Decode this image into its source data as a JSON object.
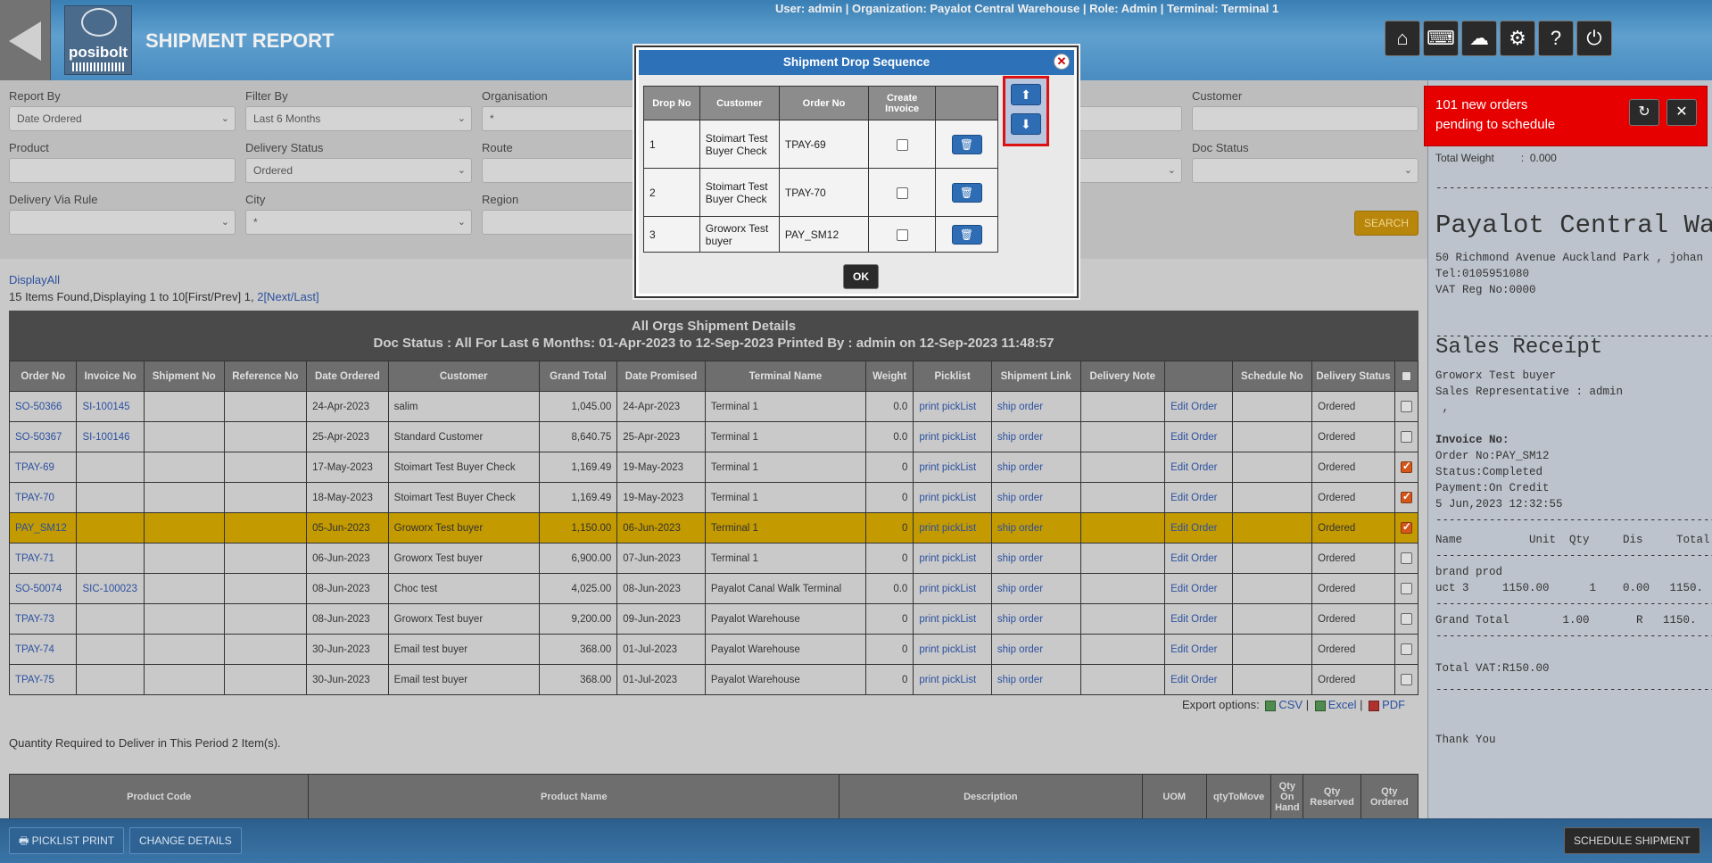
{
  "header": {
    "title": "SHIPMENT REPORT",
    "logo_text": "posibolt",
    "user_info": "User: admin | Organization: Payalot Central Warehouse | Role: Admin | Terminal: Terminal 1",
    "icons": [
      "home-icon",
      "keyboard-icon",
      "cloud-icon",
      "settings-icon",
      "help-icon",
      "power-icon"
    ]
  },
  "filters": {
    "report_by_label": "Report By",
    "report_by_value": "Date Ordered",
    "filter_by_label": "Filter By",
    "filter_by_value": "Last 6 Months",
    "organisation_label": "Organisation",
    "organisation_value": "*",
    "customer_label": "Customer",
    "customer_value": "",
    "product_label": "Product",
    "product_value": "",
    "delivery_status_label": "Delivery Status",
    "delivery_status_value": "Ordered",
    "route_label": "Route",
    "route_value": "",
    "doc_status_label": "Doc Status",
    "doc_status_value": "",
    "delivery_via_rule_label": "Delivery Via Rule",
    "delivery_via_rule_value": "",
    "city_label": "City",
    "city_value": "*",
    "region_label": "Region",
    "region_value": "",
    "search_label": "SEARCH"
  },
  "paging": {
    "display_all": "DisplayAll",
    "summary": "15 Items Found,Displaying 1 to 10[First/Prev] ",
    "page1": "1",
    "sep": ", ",
    "page2": "2",
    "next_last": "[Next/Last]"
  },
  "report": {
    "title": "All Orgs Shipment Details",
    "subtitle": "Doc Status : All For Last 6 Months: 01-Apr-2023 to 12-Sep-2023 Printed By : admin on 12-Sep-2023 11:48:57",
    "columns": [
      "Order No",
      "Invoice No",
      "Shipment No",
      "Reference No",
      "Date Ordered",
      "Customer",
      "Grand Total",
      "Date Promised",
      "Terminal Name",
      "Weight",
      "Picklist",
      "Shipment Link",
      "Delivery Note",
      "",
      "Schedule No",
      "Delivery Status"
    ],
    "picklist_text": "print pickList",
    "ship_text": "ship order",
    "edit_text": "Edit Order",
    "rows": [
      {
        "order": "SO-50366",
        "invoice": "SI-100145",
        "date": "24-Apr-2023",
        "customer": "salim",
        "total": "1,045.00",
        "promised": "24-Apr-2023",
        "terminal": "Terminal 1",
        "weight": "0.0",
        "status": "Ordered",
        "checked": false,
        "hl": false
      },
      {
        "order": "SO-50367",
        "invoice": "SI-100146",
        "date": "25-Apr-2023",
        "customer": "Standard Customer",
        "total": "8,640.75",
        "promised": "25-Apr-2023",
        "terminal": "Terminal 1",
        "weight": "0.0",
        "status": "Ordered",
        "checked": false,
        "hl": false
      },
      {
        "order": "TPAY-69",
        "invoice": "",
        "date": "17-May-2023",
        "customer": "Stoimart Test Buyer Check",
        "total": "1,169.49",
        "promised": "19-May-2023",
        "terminal": "Terminal 1",
        "weight": "0",
        "status": "Ordered",
        "checked": true,
        "hl": false
      },
      {
        "order": "TPAY-70",
        "invoice": "",
        "date": "18-May-2023",
        "customer": "Stoimart Test Buyer Check",
        "total": "1,169.49",
        "promised": "19-May-2023",
        "terminal": "Terminal 1",
        "weight": "0",
        "status": "Ordered",
        "checked": true,
        "hl": false
      },
      {
        "order": "PAY_SM12",
        "invoice": "",
        "date": "05-Jun-2023",
        "customer": "Groworx Test buyer",
        "total": "1,150.00",
        "promised": "06-Jun-2023",
        "terminal": "Terminal 1",
        "weight": "0",
        "status": "Ordered",
        "checked": true,
        "hl": true
      },
      {
        "order": "TPAY-71",
        "invoice": "",
        "date": "06-Jun-2023",
        "customer": "Groworx Test buyer",
        "total": "6,900.00",
        "promised": "07-Jun-2023",
        "terminal": "Terminal 1",
        "weight": "0",
        "status": "Ordered",
        "checked": false,
        "hl": false
      },
      {
        "order": "SO-50074",
        "invoice": "SIC-100023",
        "date": "08-Jun-2023",
        "customer": "Choc test",
        "total": "4,025.00",
        "promised": "08-Jun-2023",
        "terminal": "Payalot Canal Walk Terminal",
        "weight": "0.0",
        "status": "Ordered",
        "checked": false,
        "hl": false
      },
      {
        "order": "TPAY-73",
        "invoice": "",
        "date": "08-Jun-2023",
        "customer": "Groworx Test buyer",
        "total": "9,200.00",
        "promised": "09-Jun-2023",
        "terminal": "Payalot Warehouse",
        "weight": "0",
        "status": "Ordered",
        "checked": false,
        "hl": false
      },
      {
        "order": "TPAY-74",
        "invoice": "",
        "date": "30-Jun-2023",
        "customer": "Email test buyer",
        "total": "368.00",
        "promised": "01-Jul-2023",
        "terminal": "Payalot Warehouse",
        "weight": "0",
        "status": "Ordered",
        "checked": false,
        "hl": false
      },
      {
        "order": "TPAY-75",
        "invoice": "",
        "date": "30-Jun-2023",
        "customer": "Email test buyer",
        "total": "368.00",
        "promised": "01-Jul-2023",
        "terminal": "Payalot Warehouse",
        "weight": "0",
        "status": "Ordered",
        "checked": false,
        "hl": false
      }
    ]
  },
  "export": {
    "label": "Export options:",
    "csv": "CSV",
    "excel": "Excel",
    "pdf": "PDF",
    "sep": " | "
  },
  "qty_text": "Quantity Required to Deliver in This Period 2 Item(s).",
  "product_table": {
    "columns": [
      "Product Code",
      "Product Name",
      "Description",
      "UOM",
      "qtyToMove",
      "Qty On Hand",
      "Qty Reserved",
      "Qty Ordered"
    ]
  },
  "bottom": {
    "picklist_print": "PICKLIST PRINT",
    "change_details": "CHANGE DETAILS",
    "schedule_shipment": "SCHEDULE SHIPMENT"
  },
  "toast": {
    "line1": "101 new orders",
    "line2": "pending to schedule"
  },
  "receipt": {
    "total_weight": "Total Weight         :  0.000",
    "dashes": "--------------------------------------------",
    "store": "Payalot Central Wa",
    "address": "50 Richmond Avenue Auckland Park , johan",
    "tel": "Tel:0105951080",
    "vat": "VAT Reg No:0000",
    "heading": "Sales Receipt",
    "customer": "Groworx Test buyer",
    "rep": "Sales Representative : admin",
    "comma": " ,",
    "invoice_no": "Invoice No:",
    "order_no": "Order No:PAY_SM12",
    "status": "Status:Completed",
    "payment": "Payment:On Credit",
    "datetime": "5 Jun,2023 12:32:55",
    "item_header": "Name          Unit  Qty     Dis     Total",
    "item_line1": "brand prod",
    "item_line2": "uct 3     1150.00      1    0.00   1150.",
    "grand_total": "Grand Total        1.00       R   1150.",
    "total_vat": "Total VAT:R150.00",
    "thanks": "Thank You"
  },
  "modal": {
    "title": "Shipment Drop Sequence",
    "columns": [
      "Drop No",
      "Customer",
      "Order No",
      "Create Invoice",
      ""
    ],
    "rows": [
      {
        "drop": "1",
        "customer": "Stoimart Test Buyer Check",
        "order": "TPAY-69"
      },
      {
        "drop": "2",
        "customer": "Stoimart Test Buyer Check",
        "order": "TPAY-70"
      },
      {
        "drop": "3",
        "customer": "Groworx Test buyer",
        "order": "PAY_SM12"
      }
    ],
    "ok_label": "OK"
  }
}
